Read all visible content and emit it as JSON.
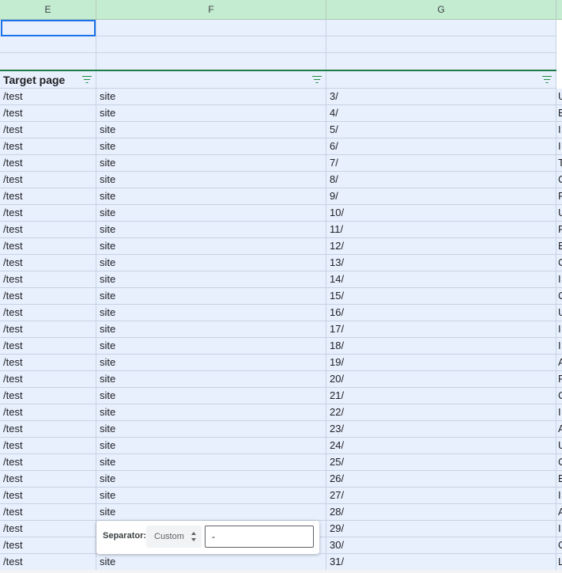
{
  "columns": [
    "E",
    "F",
    "G"
  ],
  "header_row": {
    "e": "Target page",
    "f": "",
    "g": ""
  },
  "rows": [
    {
      "e": "/test",
      "f": "site",
      "g": "3/",
      "h": "U"
    },
    {
      "e": "/test",
      "f": "site",
      "g": "4/",
      "h": "E"
    },
    {
      "e": "/test",
      "f": "site",
      "g": "5/",
      "h": "I"
    },
    {
      "e": "/test",
      "f": "site",
      "g": "6/",
      "h": "I"
    },
    {
      "e": "/test",
      "f": "site",
      "g": "7/",
      "h": "T"
    },
    {
      "e": "/test",
      "f": "site",
      "g": "8/",
      "h": "C"
    },
    {
      "e": "/test",
      "f": "site",
      "g": "9/",
      "h": "F"
    },
    {
      "e": "/test",
      "f": "site",
      "g": "10/",
      "h": "U"
    },
    {
      "e": "/test",
      "f": "site",
      "g": "11/",
      "h": "F"
    },
    {
      "e": "/test",
      "f": "site",
      "g": "12/",
      "h": "E"
    },
    {
      "e": "/test",
      "f": "site",
      "g": "13/",
      "h": "C"
    },
    {
      "e": "/test",
      "f": "site",
      "g": "14/",
      "h": "I"
    },
    {
      "e": "/test",
      "f": "site",
      "g": "15/",
      "h": "C"
    },
    {
      "e": "/test",
      "f": "site",
      "g": "16/",
      "h": "U"
    },
    {
      "e": "/test",
      "f": "site",
      "g": "17/",
      "h": "I"
    },
    {
      "e": "/test",
      "f": "site",
      "g": "18/",
      "h": "I"
    },
    {
      "e": "/test",
      "f": "site",
      "g": "19/",
      "h": "A"
    },
    {
      "e": "/test",
      "f": "site",
      "g": "20/",
      "h": "F"
    },
    {
      "e": "/test",
      "f": "site",
      "g": "21/",
      "h": "C"
    },
    {
      "e": "/test",
      "f": "site",
      "g": "22/",
      "h": "I"
    },
    {
      "e": "/test",
      "f": "site",
      "g": "23/",
      "h": "A"
    },
    {
      "e": "/test",
      "f": "site",
      "g": "24/",
      "h": "U"
    },
    {
      "e": "/test",
      "f": "site",
      "g": "25/",
      "h": "C"
    },
    {
      "e": "/test",
      "f": "site",
      "g": "26/",
      "h": "E"
    },
    {
      "e": "/test",
      "f": "site",
      "g": "27/",
      "h": "I"
    },
    {
      "e": "/test",
      "f": "site",
      "g": "28/",
      "h": "A"
    },
    {
      "e": "/test",
      "f": "",
      "g": "29/",
      "h": "I"
    },
    {
      "e": "/test",
      "f": "",
      "g": "30/",
      "h": "C"
    },
    {
      "e": "/test",
      "f": "site",
      "g": "31/",
      "h": "L"
    }
  ],
  "separator_popup": {
    "label": "Separator:",
    "mode": "Custom",
    "value": "-"
  },
  "colors": {
    "header_bg": "#c4ecd1",
    "selection_bg": "#e8f0fe",
    "filter_icon": "#1e8e3e",
    "active_border": "#1a73e8"
  }
}
